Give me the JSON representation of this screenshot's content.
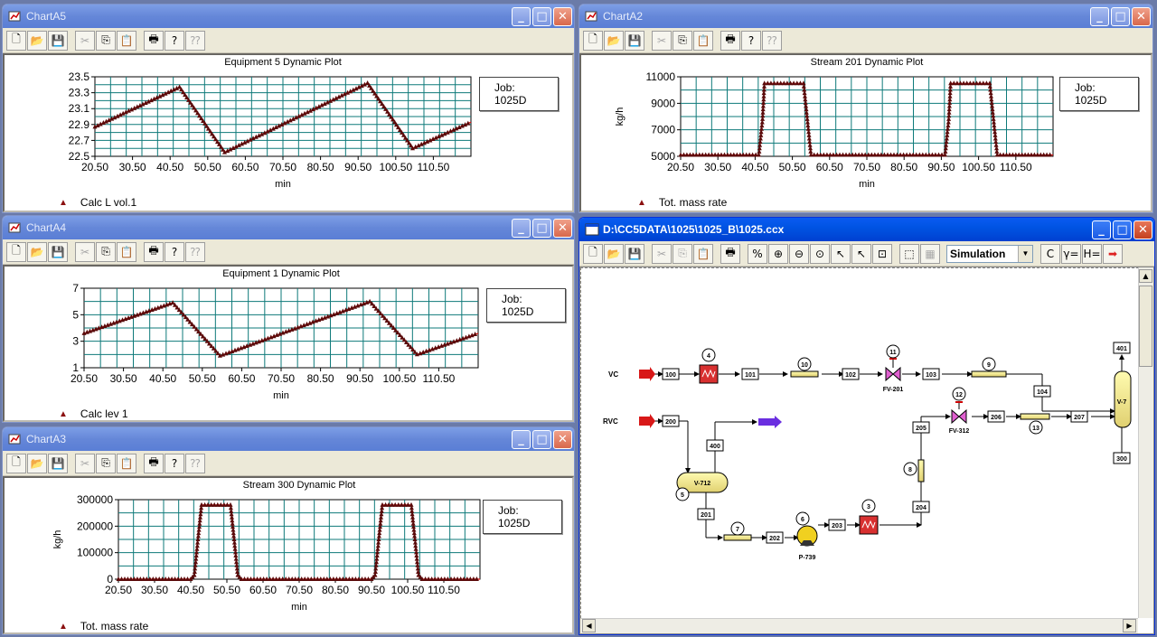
{
  "charts": [
    {
      "window_title": "ChartA5",
      "chart_title": "Equipment 5 Dynamic Plot",
      "job_label": "Job:",
      "job_value": "1025D",
      "xlabel": "min",
      "ylabel": "",
      "legend": "Calc L vol.1",
      "x_ticks": [
        "20.50",
        "30.50",
        "40.50",
        "50.50",
        "60.50",
        "70.50",
        "80.50",
        "90.50",
        "100.50",
        "110.50"
      ],
      "y_ticks": [
        "23.5",
        "23.3",
        "23.1",
        "22.9",
        "22.7",
        "22.5"
      ]
    },
    {
      "window_title": "ChartA2",
      "chart_title": "Stream 201 Dynamic Plot",
      "job_label": "Job:",
      "job_value": "1025D",
      "xlabel": "min",
      "ylabel": "kg/h",
      "legend": "Tot. mass rate",
      "x_ticks": [
        "20.50",
        "30.50",
        "40.50",
        "50.50",
        "60.50",
        "70.50",
        "80.50",
        "90.50",
        "100.50",
        "110.50"
      ],
      "y_ticks": [
        "11000",
        "9000",
        "7000",
        "5000"
      ]
    },
    {
      "window_title": "ChartA4",
      "chart_title": "Equipment 1 Dynamic Plot",
      "job_label": "Job:",
      "job_value": "1025D",
      "xlabel": "min",
      "ylabel": "",
      "legend": "Calc lev 1",
      "x_ticks": [
        "20.50",
        "30.50",
        "40.50",
        "50.50",
        "60.50",
        "70.50",
        "80.50",
        "90.50",
        "100.50",
        "110.50"
      ],
      "y_ticks": [
        "7",
        "5",
        "3",
        "1"
      ]
    },
    {
      "window_title": "ChartA3",
      "chart_title": "Stream 300 Dynamic Plot",
      "job_label": "Job:",
      "job_value": "1025D",
      "xlabel": "min",
      "ylabel": "kg/h",
      "legend": "Tot. mass rate",
      "x_ticks": [
        "20.50",
        "30.50",
        "40.50",
        "50.50",
        "60.50",
        "70.50",
        "80.50",
        "90.50",
        "100.50",
        "110.50"
      ],
      "y_ticks": [
        "300000",
        "200000",
        "100000",
        "0"
      ]
    }
  ],
  "chart_data": [
    {
      "type": "line",
      "title": "Equipment 5 Dynamic Plot",
      "xlabel": "min",
      "ylabel": "",
      "xlim": [
        20.5,
        120.5
      ],
      "ylim": [
        22.5,
        23.5
      ],
      "grid": true,
      "legend_position": "bottom-left",
      "series": [
        {
          "name": "Calc L vol.1",
          "color": "#8b1010",
          "x": [
            20.5,
            43,
            55,
            93,
            105,
            120.5
          ],
          "values": [
            22.87,
            23.37,
            22.55,
            23.42,
            22.6,
            22.93
          ]
        }
      ]
    },
    {
      "type": "line",
      "title": "Stream 201 Dynamic Plot",
      "xlabel": "min",
      "ylabel": "kg/h",
      "xlim": [
        20.5,
        120.5
      ],
      "ylim": [
        5000,
        11000
      ],
      "grid": true,
      "legend_position": "bottom-left",
      "series": [
        {
          "name": "Tot. mass rate",
          "color": "#8b1010",
          "x": [
            20.5,
            41.5,
            42.5,
            43,
            53.5,
            54.5,
            55.5,
            91.5,
            92.5,
            93,
            103.5,
            104.5,
            105.5,
            120.5
          ],
          "values": [
            5100,
            5100,
            7800,
            10500,
            10500,
            7800,
            5100,
            5100,
            7800,
            10500,
            10500,
            7800,
            5100,
            5100
          ]
        }
      ]
    },
    {
      "type": "line",
      "title": "Equipment 1 Dynamic Plot",
      "xlabel": "min",
      "ylabel": "",
      "xlim": [
        20.5,
        120.5
      ],
      "ylim": [
        1,
        7
      ],
      "grid": true,
      "legend_position": "bottom-left",
      "series": [
        {
          "name": "Calc lev 1",
          "color": "#8b1010",
          "x": [
            20.5,
            43,
            55,
            93,
            105,
            120.5
          ],
          "values": [
            3.6,
            5.9,
            1.9,
            6.0,
            2.0,
            3.6
          ]
        }
      ]
    },
    {
      "type": "line",
      "title": "Stream 300 Dynamic Plot",
      "xlabel": "min",
      "ylabel": "kg/h",
      "xlim": [
        20.5,
        120.5
      ],
      "ylim": [
        0,
        300000
      ],
      "grid": true,
      "legend_position": "bottom-left",
      "series": [
        {
          "name": "Tot. mass rate",
          "color": "#8b1010",
          "x": [
            20.5,
            40.5,
            41.5,
            42.5,
            43.5,
            51.5,
            52.5,
            53.5,
            54.5,
            90.5,
            91.5,
            92.5,
            93.5,
            101.5,
            102.5,
            103.5,
            104.5,
            120.5
          ],
          "values": [
            0,
            0,
            15000,
            150000,
            280000,
            280000,
            150000,
            15000,
            0,
            0,
            15000,
            150000,
            280000,
            280000,
            150000,
            15000,
            0,
            0
          ]
        }
      ]
    }
  ],
  "flowsheet": {
    "window_title": "D:\\CC5DATA\\1025\\1025_B\\1025.ccx",
    "mode": "Simulation",
    "toolbar_icons": [
      "new-icon",
      "open-icon",
      "save-icon",
      "cut-icon",
      "copy-icon",
      "paste-icon",
      "print-icon",
      "percent-icon",
      "zoom-in-icon",
      "zoom-out-icon",
      "zoom-fit-icon",
      "add-stream-icon",
      "delete-stream-icon",
      "select-region-icon",
      "select-box-icon",
      "grid-icon"
    ],
    "right_tools": [
      "C",
      "γ=",
      "H="
    ],
    "labels": {
      "vc": "VC",
      "rvc": "RVC",
      "s100": "100",
      "s101": "101",
      "s102": "102",
      "s103": "103",
      "s104": "104",
      "s200": "200",
      "s201": "201",
      "s202": "202",
      "s203": "203",
      "s204": "204",
      "s205": "205",
      "s206": "206",
      "s207": "207",
      "s300": "300",
      "s400": "400",
      "s401": "401",
      "u4": "4",
      "u10": "10",
      "u11": "11",
      "u9": "9",
      "u12": "12",
      "u13": "13",
      "u7": "7",
      "u6": "6",
      "u3": "3",
      "u8": "8",
      "u5": "5",
      "fv201": "FV-201",
      "fv312": "FV-312",
      "v712": "V-712",
      "p739": "P-739",
      "v7x": "V-7"
    }
  }
}
